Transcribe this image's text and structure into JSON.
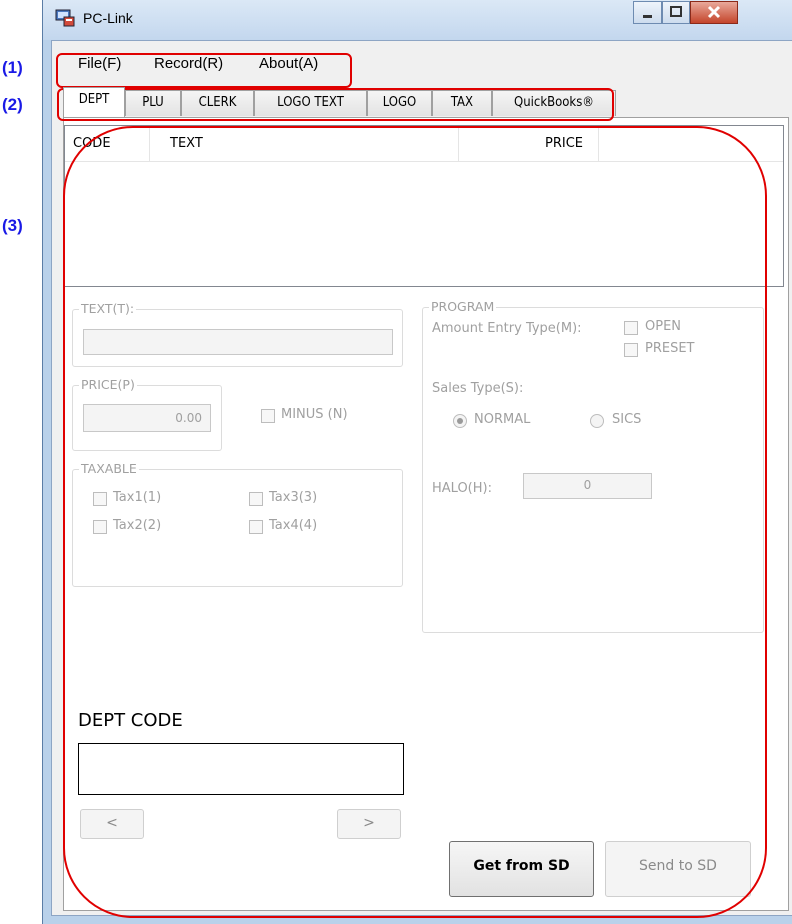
{
  "window": {
    "title": "PC-Link"
  },
  "callouts": {
    "menu": "(1)",
    "tabs": "(2)",
    "content": "(3)"
  },
  "menu": {
    "items": [
      {
        "label": "File(F)"
      },
      {
        "label": "Record(R)"
      },
      {
        "label": "About(A)"
      }
    ]
  },
  "tabs": [
    {
      "label": "DEPT",
      "active": true
    },
    {
      "label": "PLU"
    },
    {
      "label": "CLERK"
    },
    {
      "label": "LOGO TEXT"
    },
    {
      "label": "LOGO"
    },
    {
      "label": "TAX"
    },
    {
      "label": "QuickBooks®"
    }
  ],
  "list": {
    "columns": [
      "CODE",
      "TEXT",
      "PRICE"
    ]
  },
  "text_group": {
    "label": "TEXT(T):",
    "value": ""
  },
  "price_group": {
    "label": "PRICE(P)",
    "value": "0.00",
    "minus_label": "MINUS (N)"
  },
  "taxable_group": {
    "label": "TAXABLE",
    "tax1": "Tax1(1)",
    "tax2": "Tax2(2)",
    "tax3": "Tax3(3)",
    "tax4": "Tax4(4)"
  },
  "program_group": {
    "label": "PROGRAM",
    "amount_entry_label": "Amount Entry Type(M):",
    "open_label": "OPEN",
    "preset_label": "PRESET",
    "sales_type_label": "Sales Type(S):",
    "normal_label": "NORMAL",
    "sics_label": "SICS",
    "halo_label": "HALO(H):",
    "halo_value": "0",
    "sales_type_selected": "NORMAL"
  },
  "dept_code": {
    "label": "DEPT CODE",
    "value": ""
  },
  "nav": {
    "prev": "<",
    "next": ">"
  },
  "actions": {
    "get": "Get from SD",
    "send": "Send to SD"
  },
  "colors": {
    "annotation_blue": "#1a1ae6",
    "annotation_red": "#e00000",
    "window_frame": "#b9d1ea"
  }
}
